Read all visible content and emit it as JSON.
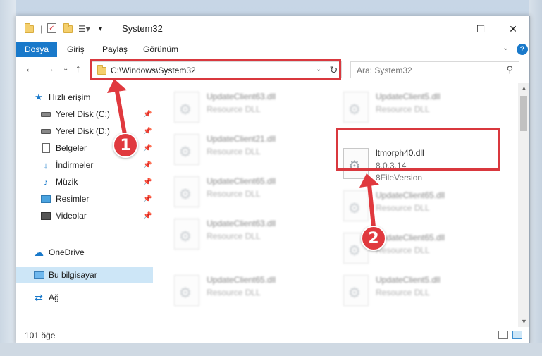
{
  "window": {
    "title": "System32"
  },
  "window_controls": {
    "minimize": "—",
    "maximize": "☐",
    "close": "✕"
  },
  "ribbon": {
    "tabs": [
      "Dosya",
      "Giriş",
      "Paylaş",
      "Görünüm"
    ],
    "help_label": "?"
  },
  "address_bar": {
    "path": "C:\\Windows\\System32"
  },
  "search": {
    "placeholder": "Ara: System32"
  },
  "sidebar": {
    "items": [
      {
        "label": "Hızlı erişim",
        "icon": "star-icon"
      },
      {
        "label": "Yerel Disk (C:)",
        "icon": "drive-icon"
      },
      {
        "label": "Yerel Disk (D:)",
        "icon": "drive-icon"
      },
      {
        "label": "Belgeler",
        "icon": "documents-icon"
      },
      {
        "label": "İndirmeler",
        "icon": "download-icon"
      },
      {
        "label": "Müzik",
        "icon": "music-icon"
      },
      {
        "label": "Resimler",
        "icon": "pictures-icon"
      },
      {
        "label": "Videolar",
        "icon": "videos-icon"
      },
      {
        "label": "OneDrive",
        "icon": "cloud-icon"
      },
      {
        "label": "Bu bilgisayar",
        "icon": "computer-icon"
      },
      {
        "label": "Ağ",
        "icon": "network-icon"
      }
    ]
  },
  "files": [
    {
      "name": "UpdateClient63.dll",
      "sub": "Resource DLL"
    },
    {
      "name": "UpdateClient5.dll",
      "sub": "Resource DLL"
    },
    {
      "name": "UpdateClient21.dll",
      "sub": "Resource DLL"
    },
    {
      "name": "ltmorph40.dll",
      "sub": "8.0.3.14",
      "sub2": "8FileVersion"
    },
    {
      "name": "UpdateClient65.dll",
      "sub": "Resource DLL"
    },
    {
      "name": "UpdateClient65.dll",
      "sub": "Resource DLL"
    },
    {
      "name": "UpdateClient63.dll",
      "sub": "Resource DLL"
    },
    {
      "name": "UpdateClient65.dll",
      "sub": "Resource DLL"
    },
    {
      "name": "UpdateClient65.dll",
      "sub": "Resource DLL"
    },
    {
      "name": "UpdateClient5.dll",
      "sub": "Resource DLL"
    }
  ],
  "status": {
    "item_count": "101 öğe"
  },
  "annotations": {
    "marker1": "1",
    "marker2": "2"
  },
  "colors": {
    "accent": "#1979ca",
    "highlight": "#d9383e",
    "selected": "#cde6f7"
  }
}
